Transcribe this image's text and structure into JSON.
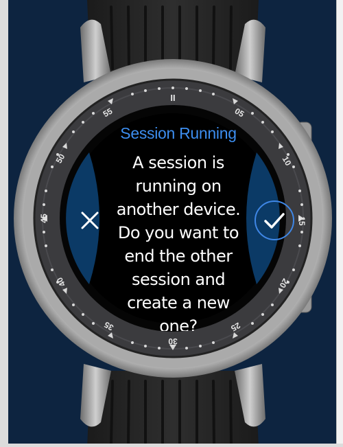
{
  "dialog": {
    "title": "Session Running",
    "message": "A session is running on another device. Do you want to end the other session and create a new one?"
  },
  "bezel": {
    "top_marker": "II",
    "numbers": [
      "05",
      "10",
      "15",
      "20",
      "25",
      "30",
      "35",
      "40",
      "45",
      "50",
      "55"
    ]
  },
  "icons": {
    "cancel": "close-icon",
    "confirm": "checkmark-icon"
  },
  "colors": {
    "title": "#3d8ef0",
    "confirm_ring": "#3f87e6",
    "screen_background": "#000000",
    "side_panels": "#0b3a66"
  }
}
